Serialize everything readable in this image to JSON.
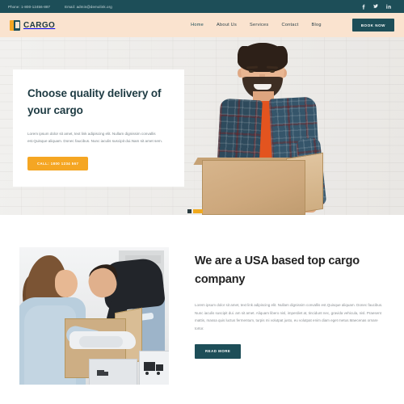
{
  "topbar": {
    "phone": "Phone: 1-800-12456-887",
    "email": "Email: admin@demolink.org",
    "socials": [
      {
        "name": "facebook-icon",
        "glyph": "f"
      },
      {
        "name": "twitter-icon",
        "glyph": "t"
      },
      {
        "name": "linkedin-icon",
        "glyph": "in"
      }
    ],
    "bg_color": "#1d4e58"
  },
  "header": {
    "logo_text": "CARGO",
    "bg_color": "#fae3cf",
    "nav": [
      {
        "label": "Home",
        "active": true
      },
      {
        "label": "About Us",
        "active": false
      },
      {
        "label": "Services",
        "active": false
      },
      {
        "label": "Contact",
        "active": false
      },
      {
        "label": "Blog",
        "active": false
      }
    ],
    "book_now_label": "BOOK NOW"
  },
  "hero": {
    "heading": "Choose quality delivery of your cargo",
    "paragraph": "Lorem ipsum dolor sit amet, text link adipiscing elit. Nullam dignissim convallis est.Quisque aliquam. Donec faucibus. Nunc iaculis suscipit dui.Nam sit amet sem.",
    "cta_label": "CALL: 1800 1234 567",
    "cta_color": "#f5a623",
    "slides": [
      {
        "label": "slide-1",
        "active": false
      },
      {
        "label": "slide-2",
        "active": true
      }
    ]
  },
  "about": {
    "heading": "We are a USA based top cargo company",
    "paragraph": "Lorem ipsum dolor sit amet, text link adipiscing elit. Nullam dignissim convallis est.Quisque aliquam. Donec faucibus. Nunc iaculis suscipit dui. am sit amet. Aliquam libero nisl, imperdiet at, tincidunt nec, gravida vehicula, nisl. Praesent mattis, massa quis luctus fermentum, turpis mi volutpat justo, eu volutpat enim diam eget metus.Maecenas ornare tortor.",
    "read_more_label": "READ MORE",
    "read_more_color": "#1d4e58"
  }
}
